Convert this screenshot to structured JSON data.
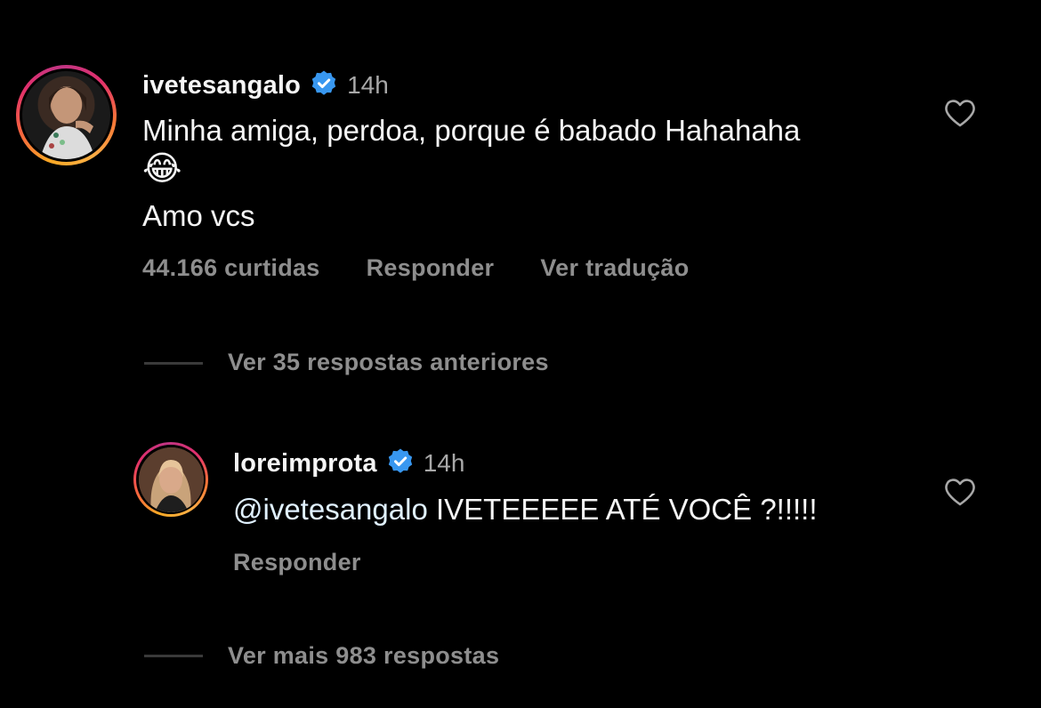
{
  "comment": {
    "username": "ivetesangalo",
    "verified": true,
    "time": "14h",
    "text_line1": "Minha amiga, perdoa, porque é babado Hahahaha",
    "emoji": "😂",
    "text_line2": "Amo vcs",
    "likes": "44.166 curtidas",
    "reply_label": "Responder",
    "translate_label": "Ver tradução"
  },
  "earlier_replies": {
    "label": "Ver 35 respostas anteriores"
  },
  "reply": {
    "username": "loreimprota",
    "verified": true,
    "time": "14h",
    "mention": "@ivetesangalo",
    "text": " IVETEEEEE ATÉ VOCÊ ?!!!!!",
    "reply_label": "Responder"
  },
  "more_replies": {
    "label": "Ver mais 983 respostas"
  },
  "colors": {
    "background": "#000000",
    "verified_blue": "#3897f0",
    "muted_text": "#8e8e8e"
  }
}
